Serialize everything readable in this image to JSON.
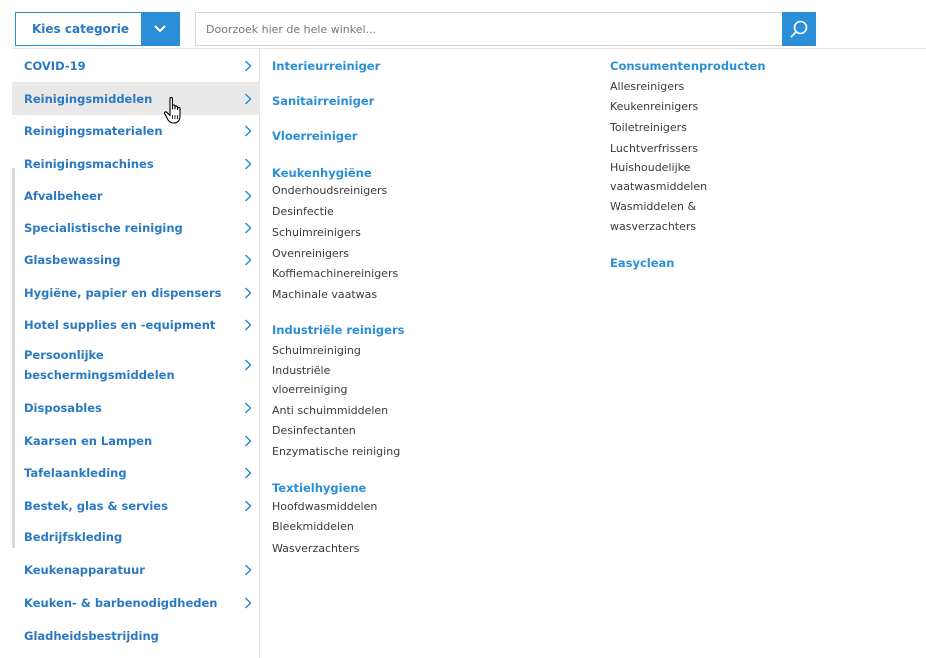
{
  "search": {
    "category_label": "Kies categorie",
    "placeholder": "Doorzoek hier de hele winkel..."
  },
  "sidebar": {
    "items": [
      {
        "label": "COVID-19",
        "has_arrow": true
      },
      {
        "label": "Reinigingsmiddelen",
        "has_arrow": true,
        "active": true
      },
      {
        "label": "Reinigingsmaterialen",
        "has_arrow": true
      },
      {
        "label": "Reinigingsmachines",
        "has_arrow": true
      },
      {
        "label": "Afvalbeheer",
        "has_arrow": true
      },
      {
        "label": "Specialistische reiniging",
        "has_arrow": true
      },
      {
        "label": "Glasbewassing",
        "has_arrow": true
      },
      {
        "label": "Hygiëne, papier en dispensers",
        "has_arrow": true
      },
      {
        "label": "Hotel supplies en -equipment",
        "has_arrow": true
      },
      {
        "label": "Persoonlijke beschermingsmiddelen",
        "label_line1": "Persoonlijke",
        "label_line2": "beschermingsmiddelen",
        "has_arrow": true
      },
      {
        "label": "Disposables",
        "has_arrow": true
      },
      {
        "label": "Kaarsen en Lampen",
        "has_arrow": true
      },
      {
        "label": "Tafelaankleding",
        "has_arrow": true
      },
      {
        "label": "Bestek, glas & servies",
        "has_arrow": true
      },
      {
        "label": "Bedrijfskleding",
        "has_arrow": false
      },
      {
        "label": "Keukenapparatuur",
        "has_arrow": true
      },
      {
        "label": "Keuken- & barbenodigdheden",
        "has_arrow": true
      },
      {
        "label": "Gladheidsbestrijding",
        "has_arrow": false
      }
    ]
  },
  "menu": {
    "col1": {
      "interieurreiniger": "Interieurreiniger",
      "sanitairreiniger": "Sanitairreiniger",
      "vloerreiniger": "Vloerreiniger",
      "keukenhygiene": {
        "title": "Keukenhygiëne",
        "items": [
          "Onderhoudsreinigers",
          "Desinfectie",
          "Schuimreinigers",
          "Ovenreinigers",
          "Koffiemachinereinigers",
          "Machinale vaatwas"
        ]
      },
      "industriele": {
        "title": "Industriële reinigers",
        "items": [
          "Schuimreiniging",
          "Industriële",
          "vloerreiniging",
          "Anti schuimmiddelen",
          "Desinfectanten",
          "Enzymatische reiniging"
        ]
      },
      "textiel": {
        "title": "Textielhygiene",
        "items": [
          "Hoofdwasmiddelen",
          "Bleekmiddelen",
          "Wasverzachters"
        ]
      }
    },
    "col2": {
      "consumenten": {
        "title": "Consumentenproducten",
        "items": [
          "Allesreinigers",
          "Keukenreinigers",
          "Toiletreinigers",
          "Luchtverfrissers",
          "Huishoudelijke",
          "vaatwasmiddelen",
          "Wasmiddelen &",
          "wasverzachters"
        ]
      },
      "easyclean": "Easyclean"
    }
  }
}
